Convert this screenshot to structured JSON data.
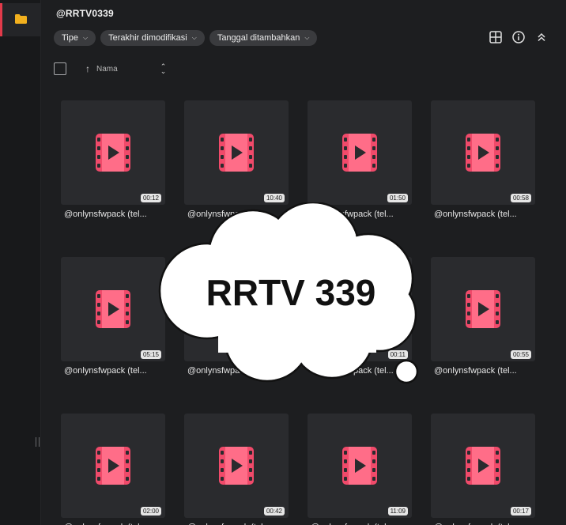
{
  "app": {
    "title": "@RRTV0339"
  },
  "filters": [
    {
      "label": "Tipe"
    },
    {
      "label": "Terakhir dimodifikasi"
    },
    {
      "label": "Tanggal ditambahkan"
    }
  ],
  "sort": {
    "label": "Nama"
  },
  "items": [
    {
      "name": "@onlynsfwpack (tel...",
      "duration": "00:12"
    },
    {
      "name": "@onlynsfwpack (tel...",
      "duration": "10:40"
    },
    {
      "name": "@onlynsfwpack (tel...",
      "duration": "01:50"
    },
    {
      "name": "@onlynsfwpack (tel...",
      "duration": "00:58"
    },
    {
      "name": "@onlynsfwpack (tel...",
      "duration": "05:15"
    },
    {
      "name": "@onlynsfwpack (tel...",
      "duration": ""
    },
    {
      "name": "@onlynsfwpack (tel...",
      "duration": "00:11"
    },
    {
      "name": "@onlynsfwpack (tel...",
      "duration": "00:55"
    },
    {
      "name": "@onlynsfwpack (tel...",
      "duration": "02:00"
    },
    {
      "name": "@onlynsfwpack (tel...",
      "duration": "00:42"
    },
    {
      "name": "@onlynsfwpack (tel...",
      "duration": "11:09"
    },
    {
      "name": "@onlynsfwpack (tel...",
      "duration": "00:17"
    }
  ],
  "overlay": {
    "text": "RRTV 339"
  },
  "colors": {
    "accent": "#e23a4a",
    "folder": "#f2b01e",
    "video_icon": "#f04a6a"
  }
}
